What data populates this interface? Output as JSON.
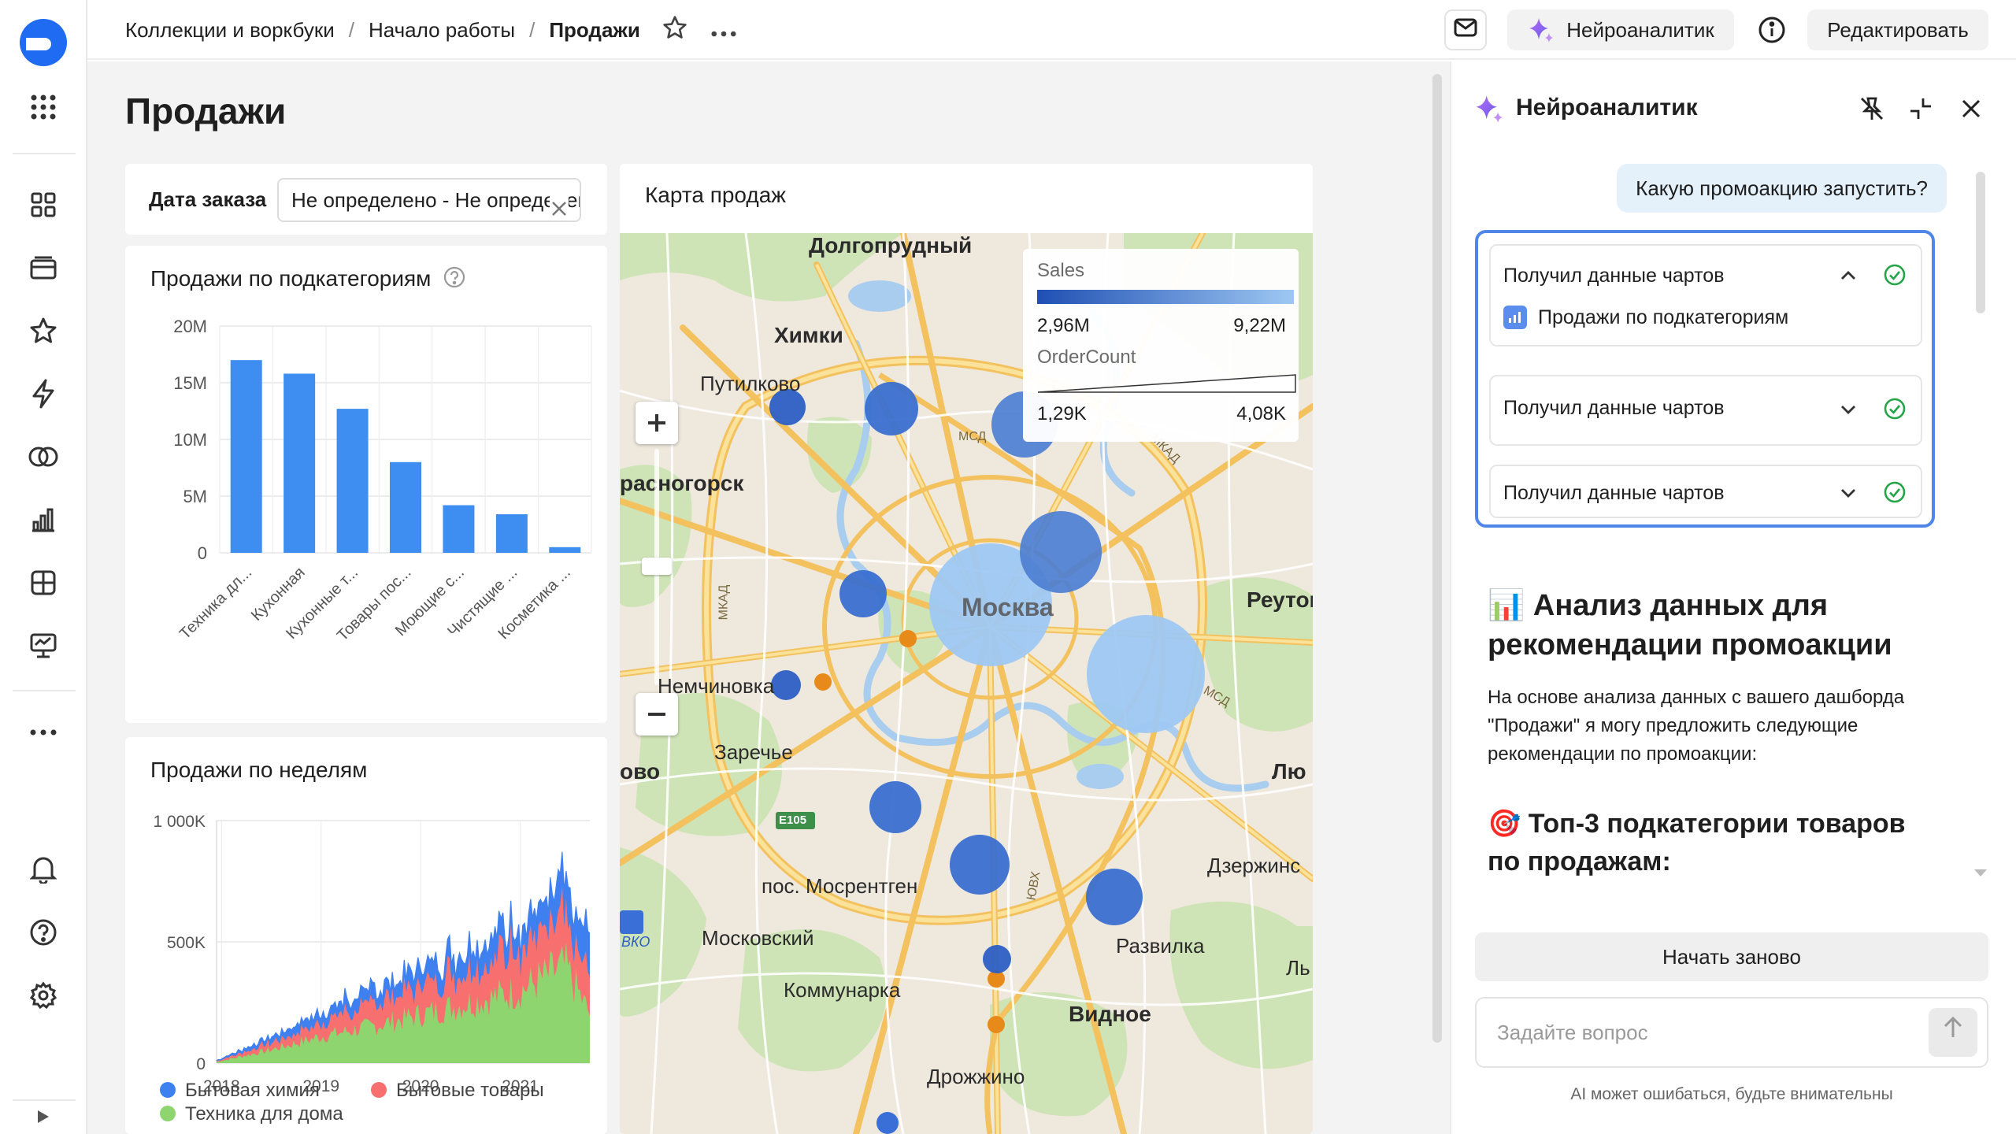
{
  "topbar": {
    "crumbs": [
      "Коллекции и воркбуки",
      "Начало работы",
      "Продажи"
    ],
    "ai_label": "Нейроаналитик",
    "edit_label": "Редактировать"
  },
  "page": {
    "title": "Продажи"
  },
  "filter": {
    "label": "Дата заказа",
    "value": "Не определено - Не определено"
  },
  "chart_data": [
    {
      "type": "bar",
      "title": "Продажи по подкатегориям",
      "categories": [
        "Техника дл...",
        "Кухонная",
        "Кухонные т...",
        "Товары пос...",
        "Моющие с...",
        "Чистящие ...",
        "Косметика ..."
      ],
      "values": [
        17000000,
        15800000,
        12700000,
        8000000,
        4200000,
        3400000,
        500000
      ],
      "ylim": [
        0,
        20000000
      ],
      "yticks": [
        0,
        5000000,
        10000000,
        15000000,
        20000000
      ],
      "ytick_labels": [
        "0",
        "5M",
        "10M",
        "15M",
        "20M"
      ],
      "color": "#3d8ef0",
      "grid": true
    },
    {
      "type": "area",
      "title": "Продажи по неделям",
      "stacked": true,
      "ylim": [
        0,
        1000000
      ],
      "yticks": [
        0,
        500000,
        1000000
      ],
      "ytick_labels": [
        "0",
        "500K",
        "1 000K"
      ],
      "xticks": [
        "2018",
        "2019",
        "2020",
        "2021"
      ],
      "x_range": [
        2017.95,
        2021.7
      ],
      "series": [
        {
          "name": "Техника для дома",
          "color": "#8ed46f",
          "anchors": [
            [
              2017.95,
              5000
            ],
            [
              2018.5,
              55000
            ],
            [
              2019.0,
              110000
            ],
            [
              2019.5,
              150000
            ],
            [
              2020.0,
              200000
            ],
            [
              2020.5,
              250000
            ],
            [
              2021.0,
              300000
            ],
            [
              2021.45,
              400000
            ],
            [
              2021.7,
              200000
            ]
          ]
        },
        {
          "name": "Бытовые товары",
          "color": "#f76f6f",
          "anchors": [
            [
              2017.95,
              3000
            ],
            [
              2018.5,
              30000
            ],
            [
              2019.0,
              60000
            ],
            [
              2019.5,
              90000
            ],
            [
              2020.0,
              120000
            ],
            [
              2020.5,
              150000
            ],
            [
              2021.0,
              180000
            ],
            [
              2021.45,
              200000
            ],
            [
              2021.7,
              160000
            ]
          ]
        },
        {
          "name": "Бытовая химия",
          "color": "#3e80ef",
          "anchors": [
            [
              2017.95,
              2000
            ],
            [
              2018.5,
              25000
            ],
            [
              2019.0,
              40000
            ],
            [
              2019.5,
              60000
            ],
            [
              2020.0,
              70000
            ],
            [
              2020.5,
              85000
            ],
            [
              2021.0,
              100000
            ],
            [
              2021.45,
              140000
            ],
            [
              2021.7,
              150000
            ]
          ]
        }
      ],
      "legend": [
        "Бытовая химия",
        "Бытовые товары",
        "Техника для дома"
      ],
      "legend_placement": "bottom",
      "grid": true
    }
  ],
  "map": {
    "title": "Карта продаж",
    "legend": {
      "sales_title": "Sales",
      "sales_min": "2,96M",
      "sales_max": "9,22M",
      "count_title": "OrderCount",
      "count_min": "1,29K",
      "count_max": "4,08K"
    },
    "place_labels": {
      "dolgoprudny": "Долгопрудный",
      "khimki": "Химки",
      "putilkovo": "Путилково",
      "krasnogorsk": "расногорск",
      "moskva": "Москва",
      "reutov": "Реутов",
      "nemchinovka": "Немчиновка",
      "zarechye": "Заречье",
      "lyu": "Лю",
      "dzerzh": "Дзержинс",
      "odintsovo": "ово",
      "mosrentgen": "пос. Мосрентген",
      "moskovsky": "Московский",
      "kommunarka": "Коммунарка",
      "razvilka": "Развилка",
      "vidnoe": "Видное",
      "ly2": "Ль",
      "drozhzhino": "Дрожжино",
      "vko": "ВКО",
      "e105": "E105",
      "mkad1": "МКАД",
      "mkad2": "МКАД",
      "msd1": "МСД",
      "msd2": "МСД",
      "yuvh": "ЮВХ"
    }
  },
  "assistant": {
    "title": "Нейроаналитик",
    "user_message": "Какую промоакцию запустить?",
    "tools": [
      {
        "label": "Получил данные чартов",
        "chart": "Продажи по подкатегориям",
        "expanded": true
      },
      {
        "label": "Получил данные чартов",
        "expanded": false
      },
      {
        "label": "Получил данные чартов",
        "expanded": false
      }
    ],
    "heading1": "📊 Анализ данных для рекомендации промоакции",
    "paragraph": "На основе анализа данных с вашего дашборда \"Продажи\" я могу предложить следующие рекомендации по промоакции:",
    "heading2": "🎯 Топ-3 подкатегории товаров по продажам:",
    "restart_label": "Начать заново",
    "input_placeholder": "Задайте вопрос",
    "disclaimer": "AI может ошибаться, будьте внимательны"
  },
  "colors": {
    "accent": "#3d8ef0",
    "primary_blue": "#2b5fc7",
    "focus": "#4f86e8",
    "success": "#22a447"
  }
}
